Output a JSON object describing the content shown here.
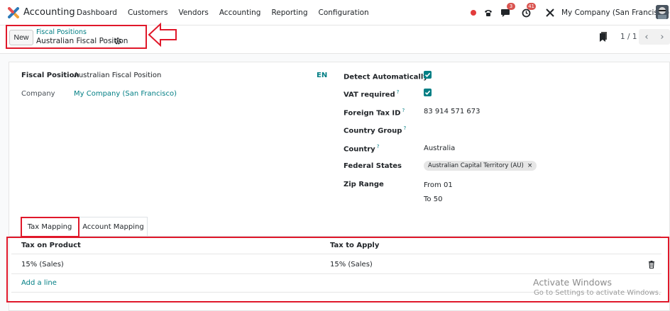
{
  "topbar": {
    "app_name": "Accounting",
    "menu": [
      "Dashboard",
      "Customers",
      "Vendors",
      "Accounting",
      "Reporting",
      "Configuration"
    ],
    "messages_count": "3",
    "activities_count": "41",
    "company": "My Company (San Francisco)"
  },
  "control": {
    "new_label": "New",
    "breadcrumb_parent": "Fiscal Positions",
    "breadcrumb_current": "Australian Fiscal Position",
    "pager": "1 / 1"
  },
  "form": {
    "fiscal_position_label": "Fiscal Position",
    "fiscal_position_value": "Australian Fiscal Position",
    "lang": "EN",
    "company_label": "Company",
    "company_value": "My Company (San Francisco)",
    "detect_label": "Detect Automatically",
    "detect_checked": true,
    "vat_label": "VAT required",
    "vat_checked": true,
    "foreign_tax_label": "Foreign Tax ID",
    "foreign_tax_value": "83 914 571 673",
    "country_group_label": "Country Group",
    "country_label": "Country",
    "country_value": "Australia",
    "federal_label": "Federal States",
    "federal_tag": "Australian Capital Territory (AU)",
    "zip_label": "Zip Range",
    "zip_from": "From 01",
    "zip_to": "To 50",
    "help_mark": "?"
  },
  "tabs": [
    "Tax Mapping",
    "Account Mapping"
  ],
  "table": {
    "headers": [
      "Tax on Product",
      "Tax to Apply"
    ],
    "rows": [
      [
        "15% (Sales)",
        "15% (Sales)"
      ]
    ],
    "add_line": "Add a line"
  },
  "watermark": {
    "line1": "Activate Windows",
    "line2": "Go to Settings to activate Windows."
  },
  "colors": {
    "brand": "#017e84",
    "annotation": "#e0182a"
  }
}
